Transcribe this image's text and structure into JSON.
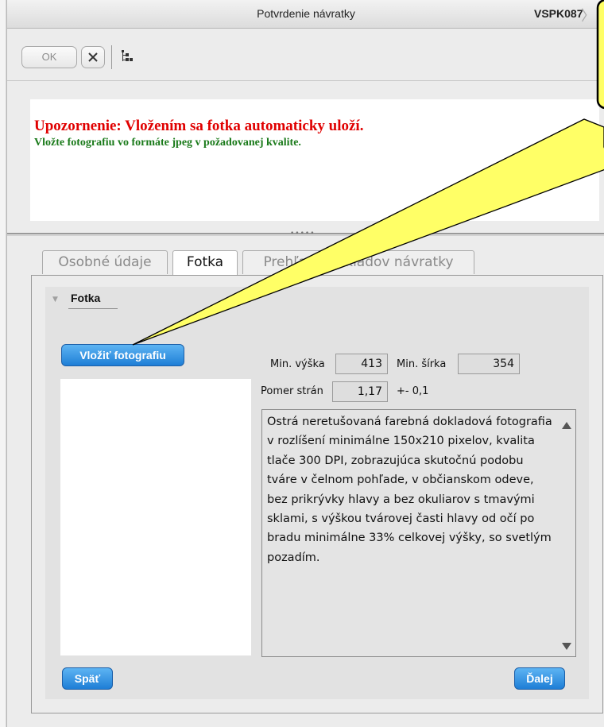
{
  "window": {
    "title": "Potvrdenie návratky",
    "code": "VSPK087"
  },
  "toolbar": {
    "ok_label": "OK"
  },
  "notice": {
    "warning": "Upozornenie: Vložením sa fotka automaticky uloží.",
    "instruction": "Vložte fotografiu vo formáte jpeg v požadovanej kvalite."
  },
  "tabs": [
    {
      "label": "Osobné údaje",
      "active": false
    },
    {
      "label": "Fotka",
      "active": true
    },
    {
      "label": "Prehľad podkladov návratky",
      "active": false
    }
  ],
  "section": {
    "title": "Fotka"
  },
  "buttons": {
    "insert_photo": "Vložiť fotografiu",
    "back": "Späť",
    "next": "Ďalej"
  },
  "requirements": {
    "min_height_label": "Min. výška",
    "min_height_value": "413",
    "min_width_label": "Min. šírka",
    "min_width_value": "354",
    "ratio_label": "Pomer strán",
    "ratio_value": "1,17",
    "tolerance": "+- 0,1"
  },
  "description": "Ostrá neretušovaná farebná dokladová fotografia v rozlíšení minimálne 150x210 pixelov, kvalita tlače 300 DPI, zobrazujúca skutočnú podobu tváre v čelnom pohľade, v občianskom odeve, bez prikrývky hlavy a bez okuliarov s tmavými sklami, s výškou tvárovej časti hlavy od očí po bradu minimálne 33% celkovej výšky, so svetlým pozadím.",
  "colors": {
    "warning": "#e00000",
    "instruction": "#1a7a1a",
    "primary_button": "#1e7ed6",
    "callout": "#ffff66"
  },
  "icons": {
    "cancel": "close-icon",
    "tree": "tree-structure-icon"
  }
}
